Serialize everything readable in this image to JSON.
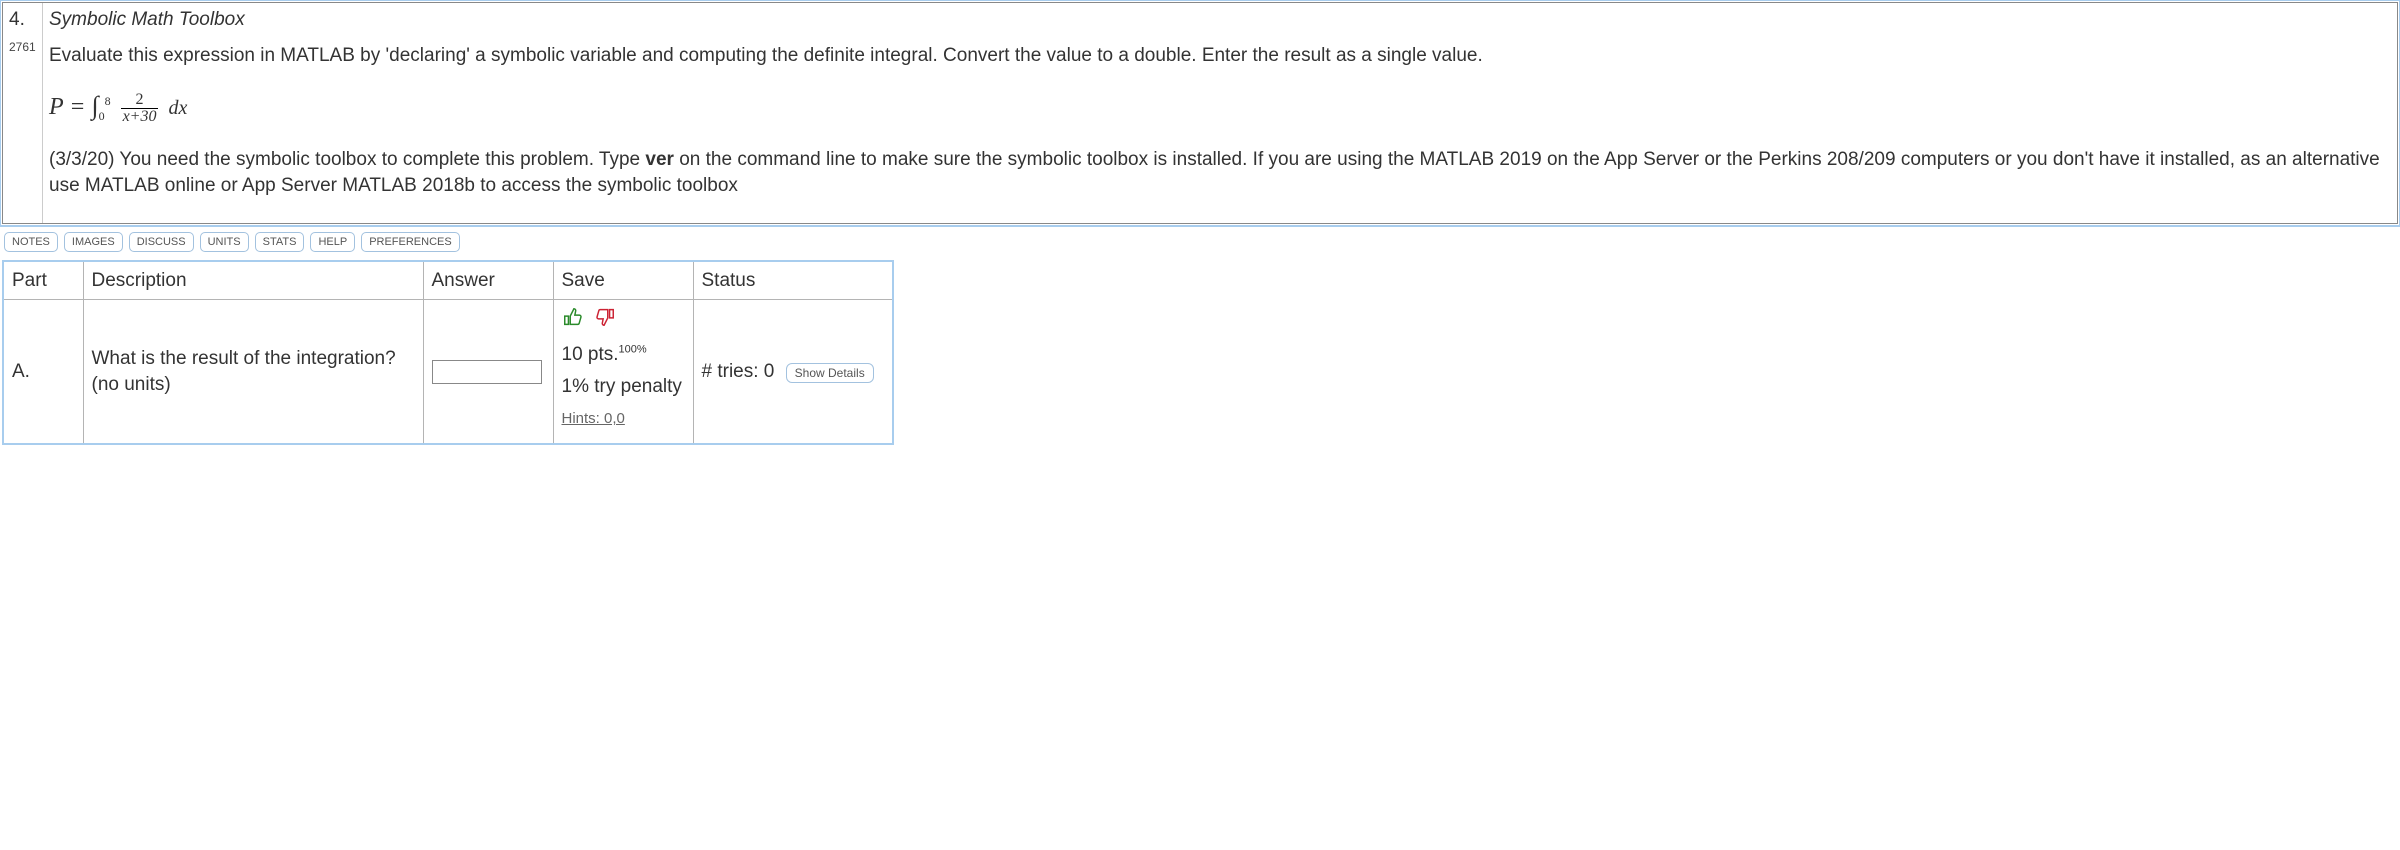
{
  "question": {
    "number": "4.",
    "id": "2761",
    "title": "Symbolic Math Toolbox",
    "prompt": "Evaluate this expression in MATLAB by 'declaring' a symbolic variable and computing the definite integral. Convert the value to a double. Enter the result as a single value.",
    "equation": {
      "lhs": "P",
      "lower": "0",
      "upper": "8",
      "numerator": "2",
      "denominator_var": "x",
      "denominator_const": "+30",
      "dvar": "dx"
    },
    "note_prefix": "(3/3/20) You need the symbolic toolbox to complete this problem. Type ",
    "note_cmd": "ver",
    "note_suffix": " on the command line to make sure the symbolic toolbox is installed. If you are using the MATLAB 2019 on the App Server or the Perkins 208/209 computers or you don't have it installed, as an alternative use MATLAB online or App Server MATLAB 2018b to access the symbolic toolbox"
  },
  "buttons": {
    "notes": "NOTES",
    "images": "IMAGES",
    "discuss": "DISCUSS",
    "units": "UNITS",
    "stats": "STATS",
    "help": "HELP",
    "preferences": "PREFERENCES"
  },
  "table": {
    "headers": {
      "part": "Part",
      "description": "Description",
      "answer": "Answer",
      "save": "Save",
      "status": "Status"
    },
    "row": {
      "part": "A.",
      "description": "What is the result of the integration? (no units)",
      "points_text": "10 pts.",
      "percent": "100%",
      "penalty": "1% try penalty",
      "hints": "Hints: 0,0",
      "tries_label": "# tries: 0",
      "details": "Show Details"
    }
  }
}
